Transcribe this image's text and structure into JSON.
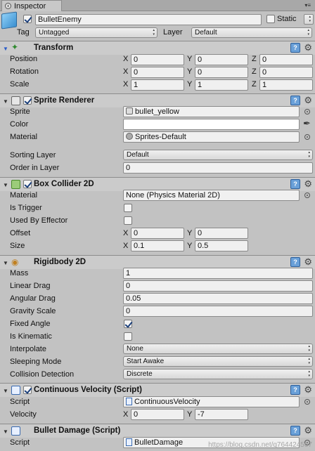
{
  "tab": {
    "label": "Inspector"
  },
  "header": {
    "name": "BulletEnemy",
    "static_label": "Static",
    "tag_label": "Tag",
    "tag_value": "Untagged",
    "layer_label": "Layer",
    "layer_value": "Default"
  },
  "transform": {
    "title": "Transform",
    "rows": [
      {
        "label": "Position",
        "x": "0",
        "y": "0",
        "z": "0"
      },
      {
        "label": "Rotation",
        "x": "0",
        "y": "0",
        "z": "0"
      },
      {
        "label": "Scale",
        "x": "1",
        "y": "1",
        "z": "1"
      }
    ]
  },
  "axes": {
    "x": "X",
    "y": "Y",
    "z": "Z"
  },
  "sprite_renderer": {
    "title": "Sprite Renderer",
    "sprite_label": "Sprite",
    "sprite_value": "bullet_yellow",
    "color_label": "Color",
    "color_value": "#ffffff",
    "material_label": "Material",
    "material_value": "Sprites-Default",
    "sorting_layer_label": "Sorting Layer",
    "sorting_layer_value": "Default",
    "order_label": "Order in Layer",
    "order_value": "0"
  },
  "box_collider": {
    "title": "Box Collider 2D",
    "material_label": "Material",
    "material_value": "None (Physics Material 2D)",
    "trigger_label": "Is Trigger",
    "effector_label": "Used By Effector",
    "offset_label": "Offset",
    "offset_x": "0",
    "offset_y": "0",
    "size_label": "Size",
    "size_x": "0.1",
    "size_y": "0.5"
  },
  "rigidbody": {
    "title": "Rigidbody 2D",
    "mass_label": "Mass",
    "mass_value": "1",
    "linear_drag_label": "Linear Drag",
    "linear_drag_value": "0",
    "angular_drag_label": "Angular Drag",
    "angular_drag_value": "0.05",
    "gravity_label": "Gravity Scale",
    "gravity_value": "0",
    "fixed_angle_label": "Fixed Angle",
    "kinematic_label": "Is Kinematic",
    "interpolate_label": "Interpolate",
    "interpolate_value": "None",
    "sleeping_label": "Sleeping Mode",
    "sleeping_value": "Start Awake",
    "collision_label": "Collision Detection",
    "collision_value": "Discrete"
  },
  "continuous_velocity": {
    "title": "Continuous Velocity (Script)",
    "script_label": "Script",
    "script_value": "ContinuousVelocity",
    "velocity_label": "Velocity",
    "velocity_x": "0",
    "velocity_y": "-7"
  },
  "bullet_damage": {
    "title": "Bullet Damage (Script)",
    "script_label": "Script",
    "script_value": "BulletDamage"
  },
  "watermark": "https://blog.csdn.net/q764424567"
}
